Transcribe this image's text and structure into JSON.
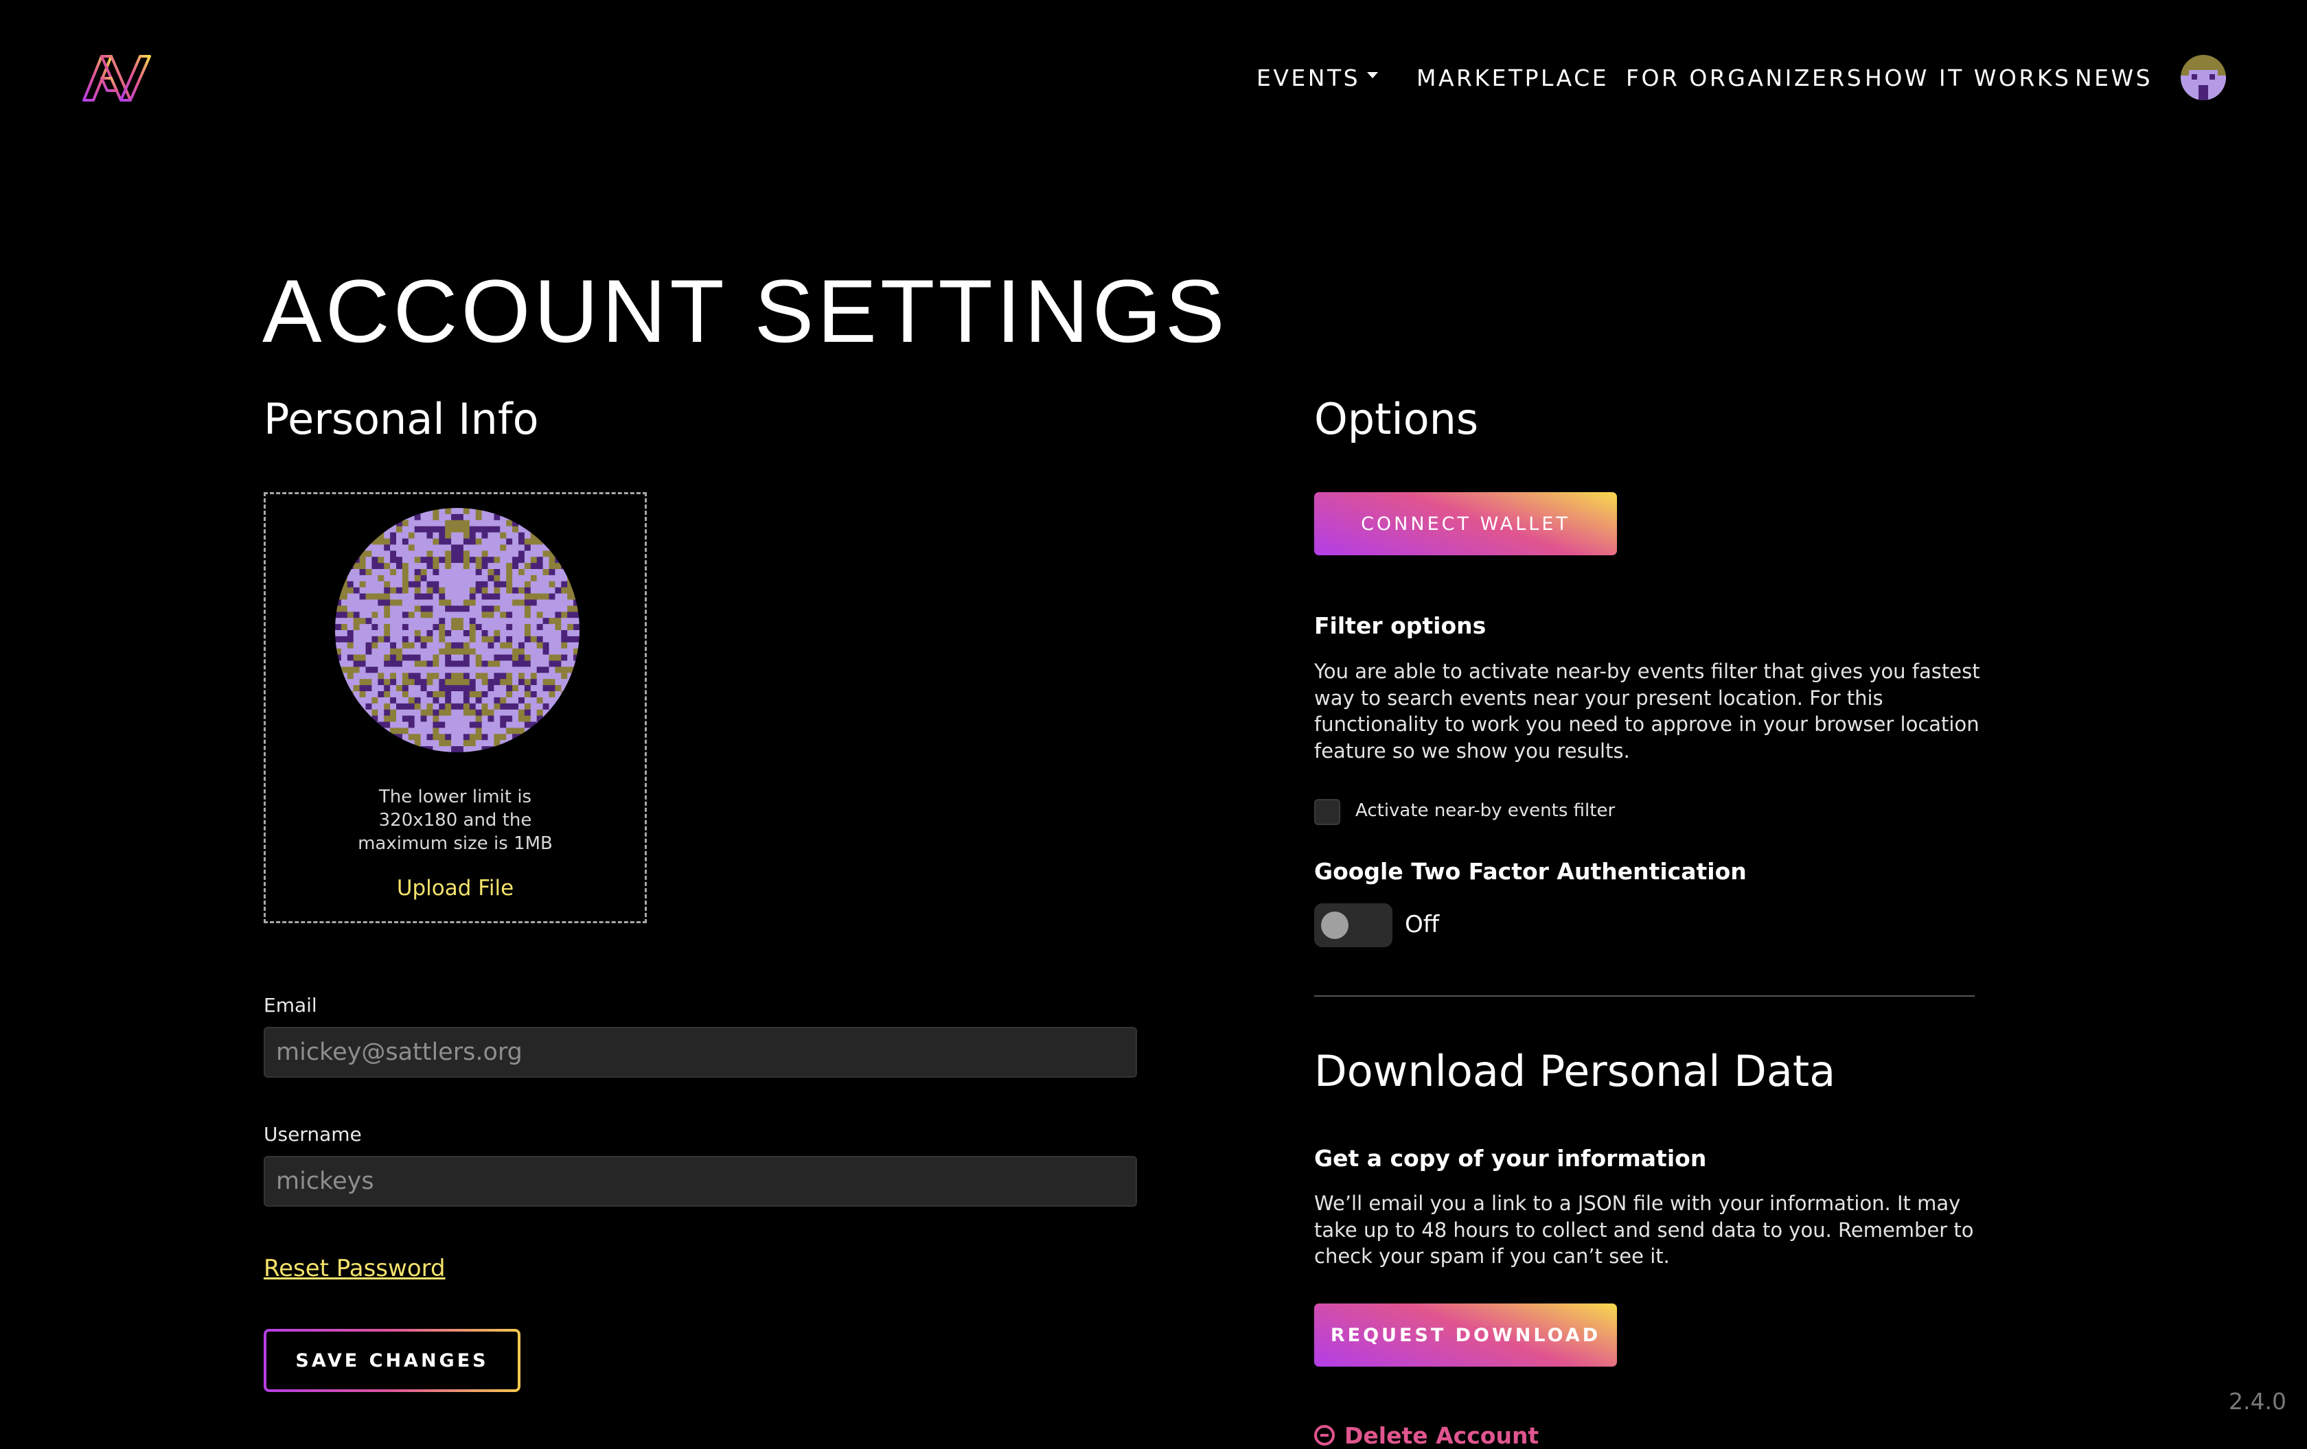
{
  "nav": {
    "events_label": "EVENTS",
    "marketplace_label": "MARKETPLACE",
    "organizers_label": "FOR ORGANIZERS",
    "how_it_works_label": "HOW IT WORKS",
    "news_label": "NEWS"
  },
  "page": {
    "title": "ACCOUNT SETTINGS",
    "version": "2.4.0"
  },
  "personal_info": {
    "title": "Personal Info",
    "upload_hint_lines": [
      "The lower limit is",
      "320x180 and the",
      "maximum size is 1MB"
    ],
    "upload_link": "Upload File",
    "email_label": "Email",
    "email_placeholder": "mickey@sattlers.org",
    "username_label": "Username",
    "username_placeholder": "mickeys",
    "reset_password": "Reset Password",
    "save_button": "SAVE CHANGES"
  },
  "options": {
    "title": "Options",
    "connect_wallet": "CONNECT WALLET",
    "filter_title": "Filter options",
    "filter_text": "You are able to activate near-by events filter that gives you fastest way to search events near your present location. For this functionality to work you need to approve in your browser location feature so we show you results.",
    "filter_checkbox_label": "Activate near-by events filter",
    "twofa_title": "Google Two Factor Authentication",
    "twofa_state": "Off"
  },
  "download": {
    "title": "Download Personal Data",
    "subtitle": "Get a copy of your information",
    "text": "We’ll email you a link to a JSON file with your information. It may take up to 48 hours to collect and send data to you. Remember to check your spam if you can’t see it.",
    "button": "REQUEST DOWNLOAD",
    "delete_label": "Delete Account"
  },
  "colors": {
    "background": "#000000",
    "accent_yellow": "#f5e36b",
    "gradient_purple": "#b23ee8",
    "gradient_pink": "#e0558f",
    "gradient_yellow": "#f7d94e",
    "avatar_light": "#b59be6",
    "avatar_dark": "#4a2378",
    "avatar_olive": "#8c7f3a"
  },
  "icons": {
    "logo": "brand-logo-icon",
    "events_caret": "caret-down-icon",
    "avatar": "user-avatar",
    "delete": "minus-circle-icon"
  }
}
